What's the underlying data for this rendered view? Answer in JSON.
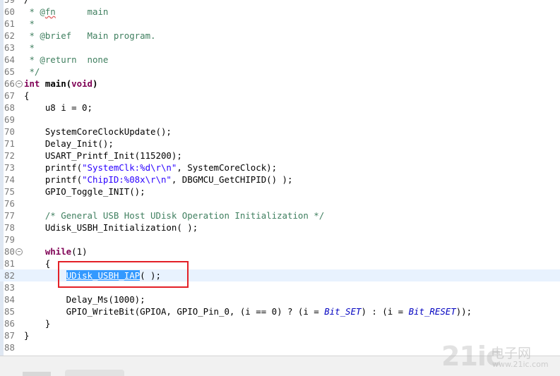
{
  "editor": {
    "lines": [
      {
        "n": "59",
        "segs": [
          {
            "t": "/"
          }
        ]
      },
      {
        "n": "60",
        "segs": [
          {
            "c": "cm",
            "t": " * @"
          },
          {
            "c": "cm squig",
            "t": "fn"
          },
          {
            "c": "cm",
            "t": "      main"
          }
        ]
      },
      {
        "n": "61",
        "segs": [
          {
            "c": "cm",
            "t": " *"
          }
        ]
      },
      {
        "n": "62",
        "segs": [
          {
            "c": "cm",
            "t": " * @brief   Main program."
          }
        ]
      },
      {
        "n": "63",
        "segs": [
          {
            "c": "cm",
            "t": " *"
          }
        ]
      },
      {
        "n": "64",
        "segs": [
          {
            "c": "cm",
            "t": " * @return  none"
          }
        ]
      },
      {
        "n": "65",
        "segs": [
          {
            "c": "cm",
            "t": " */"
          }
        ]
      },
      {
        "n": "66",
        "fold": true,
        "segs": [
          {
            "c": "kw",
            "t": "int"
          },
          {
            "t": " "
          },
          {
            "t": "main(",
            "b": true
          },
          {
            "c": "kw",
            "t": "void"
          },
          {
            "t": ")",
            "b": true
          }
        ]
      },
      {
        "n": "67",
        "segs": [
          {
            "t": "{"
          }
        ]
      },
      {
        "n": "68",
        "segs": [
          {
            "t": "    u8 i = 0;"
          }
        ]
      },
      {
        "n": "69",
        "segs": [
          {
            "t": ""
          }
        ]
      },
      {
        "n": "70",
        "segs": [
          {
            "t": "    SystemCoreClockUpdate();"
          }
        ]
      },
      {
        "n": "71",
        "segs": [
          {
            "t": "    Delay_Init();"
          }
        ]
      },
      {
        "n": "72",
        "segs": [
          {
            "t": "    USART_Printf_Init(115200);"
          }
        ]
      },
      {
        "n": "73",
        "segs": [
          {
            "t": "    printf("
          },
          {
            "c": "str",
            "t": "\"SystemClk:%d\\r\\n\""
          },
          {
            "t": ", SystemCoreClock);"
          }
        ]
      },
      {
        "n": "74",
        "segs": [
          {
            "t": "    printf("
          },
          {
            "c": "str",
            "t": "\"ChipID:%08x\\r\\n\""
          },
          {
            "t": ", DBGMCU_GetCHIPID() );"
          }
        ]
      },
      {
        "n": "75",
        "segs": [
          {
            "t": "    GPIO_Toggle_INIT();"
          }
        ]
      },
      {
        "n": "76",
        "segs": [
          {
            "t": ""
          }
        ]
      },
      {
        "n": "77",
        "segs": [
          {
            "t": "    "
          },
          {
            "c": "cm",
            "t": "/* General USB Host UDisk Operation Initialization */"
          }
        ]
      },
      {
        "n": "78",
        "segs": [
          {
            "t": "    Udisk_USBH_Initialization( );"
          }
        ]
      },
      {
        "n": "79",
        "segs": [
          {
            "t": ""
          }
        ]
      },
      {
        "n": "80",
        "fold": true,
        "segs": [
          {
            "t": "    "
          },
          {
            "c": "kw",
            "t": "while"
          },
          {
            "t": "(1)"
          }
        ]
      },
      {
        "n": "81",
        "segs": [
          {
            "t": "    {"
          }
        ]
      },
      {
        "n": "82",
        "current": true,
        "segs": [
          {
            "t": "        "
          },
          {
            "c": "sel",
            "t": "UDisk_USBH_IAP"
          },
          {
            "t": "( );"
          }
        ]
      },
      {
        "n": "83",
        "segs": [
          {
            "t": ""
          }
        ]
      },
      {
        "n": "84",
        "segs": [
          {
            "t": "        Delay_Ms(1000);"
          }
        ]
      },
      {
        "n": "85",
        "segs": [
          {
            "t": "        GPIO_WriteBit(GPIOA, GPIO_Pin_0, (i == 0) ? (i = "
          },
          {
            "c": "it",
            "t": "Bit_SET"
          },
          {
            "t": ") : (i = "
          },
          {
            "c": "it",
            "t": "Bit_RESET"
          },
          {
            "t": "));"
          }
        ]
      },
      {
        "n": "86",
        "segs": [
          {
            "t": "    }"
          }
        ]
      },
      {
        "n": "87",
        "segs": [
          {
            "t": "}"
          }
        ]
      },
      {
        "n": "88",
        "segs": [
          {
            "t": ""
          }
        ]
      }
    ]
  },
  "watermark": {
    "logo_text": "21ic",
    "cn_text": "电子网",
    "url_text": "www.21ic.com"
  },
  "colors": {
    "comment": "#3f7f5f",
    "keyword": "#7f0055",
    "string": "#2a00ff",
    "enum": "#0000c0",
    "selection": "#3399ff",
    "highlight_box": "#e32027",
    "line_numbers": "#787878"
  }
}
